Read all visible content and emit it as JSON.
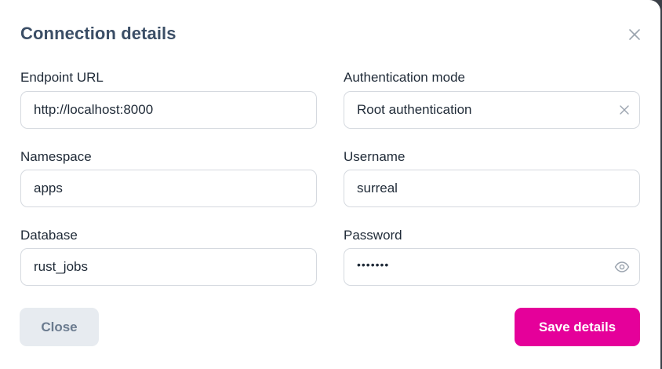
{
  "dialog": {
    "title": "Connection details",
    "close_icon": "close-icon"
  },
  "fields": {
    "endpoint": {
      "label": "Endpoint URL",
      "value": "http://localhost:8000"
    },
    "auth_mode": {
      "label": "Authentication mode",
      "value": "Root authentication",
      "clear_icon": "clear-icon"
    },
    "namespace": {
      "label": "Namespace",
      "value": "apps"
    },
    "username": {
      "label": "Username",
      "value": "surreal"
    },
    "database": {
      "label": "Database",
      "value": "rust_jobs"
    },
    "password": {
      "label": "Password",
      "value": "•••••••",
      "reveal_icon": "eye-icon"
    }
  },
  "buttons": {
    "close_label": "Close",
    "save_label": "Save details"
  },
  "colors": {
    "title": "#3b4e66",
    "accent": "#e5009a",
    "secondary_button_bg": "#e7ebf0",
    "secondary_button_text": "#6b7b8f",
    "input_border": "#d5d9df"
  }
}
